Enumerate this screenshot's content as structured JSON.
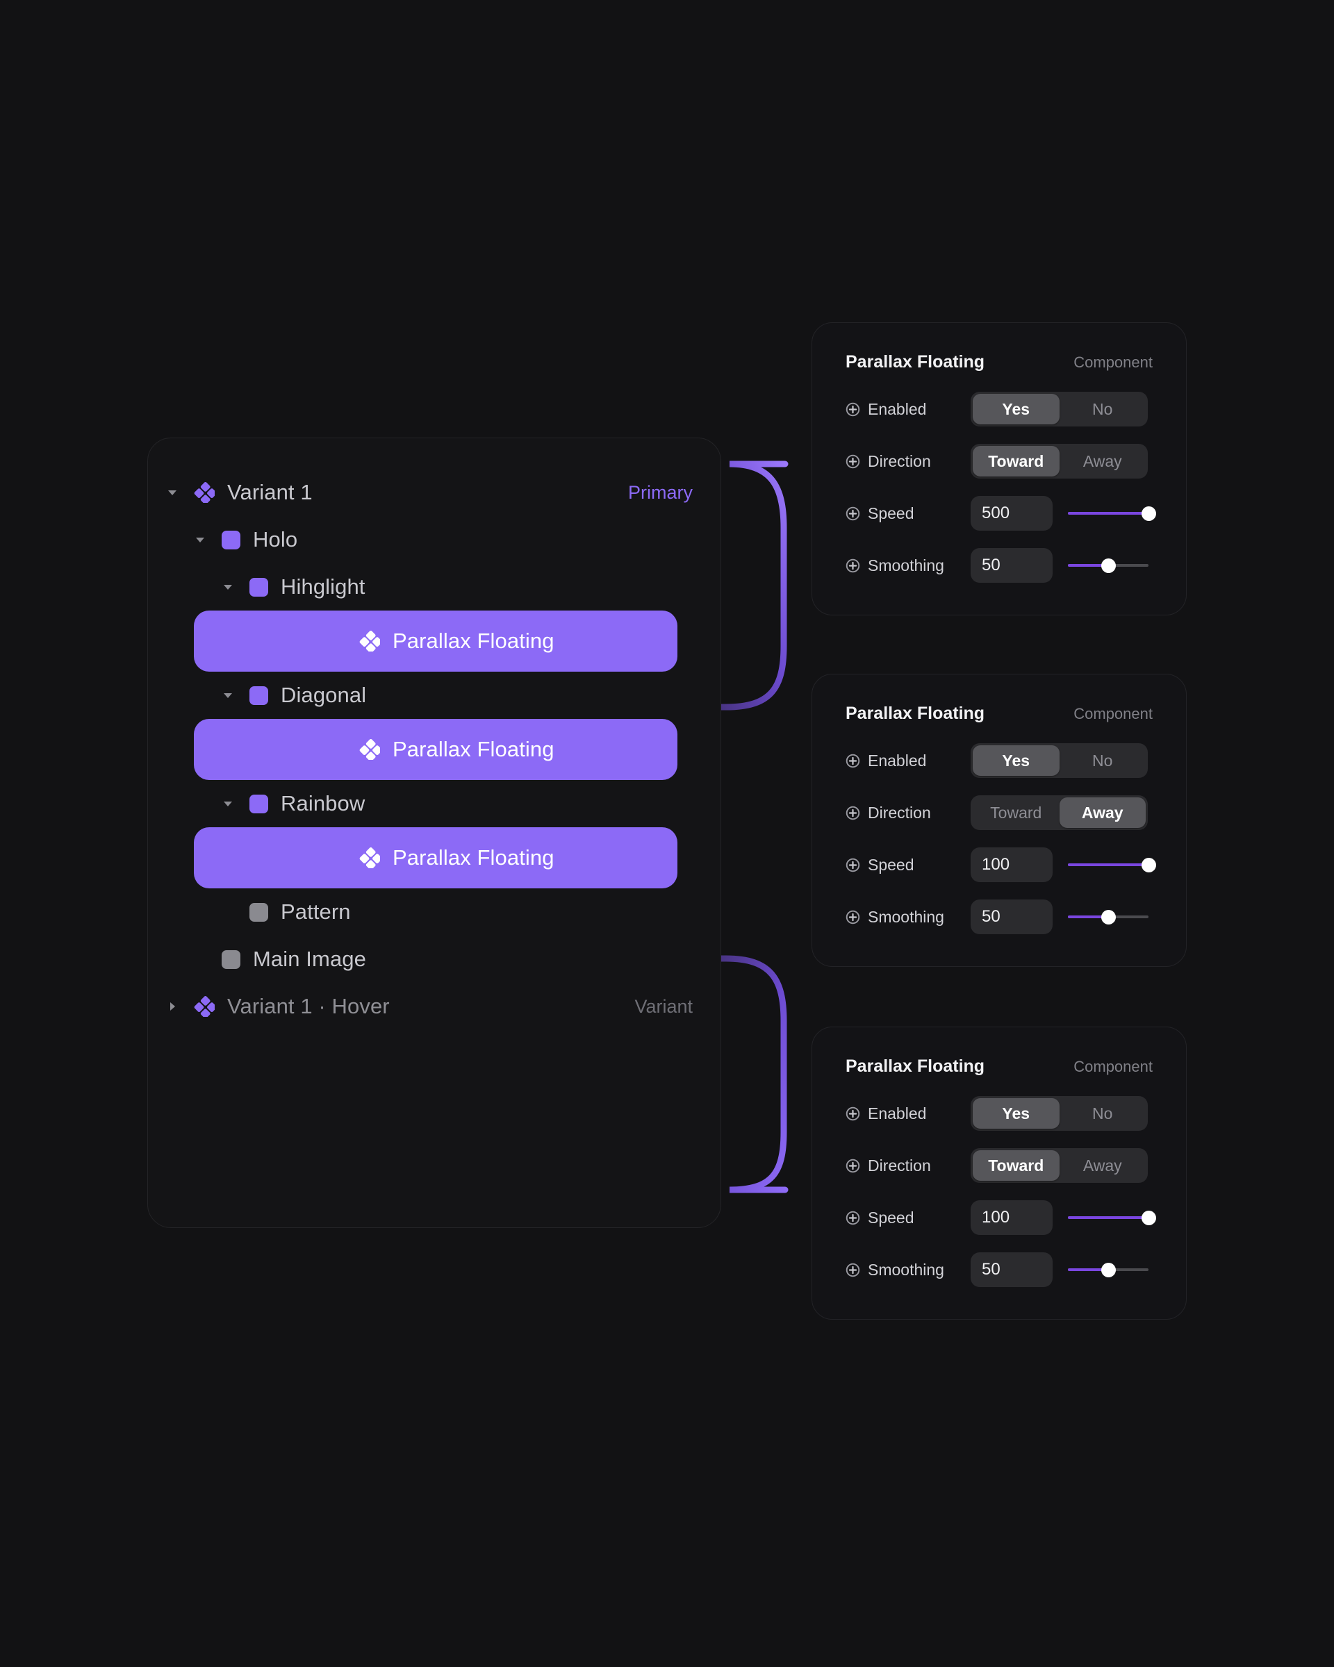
{
  "theme": {
    "background": "#121214",
    "accent_purple": "#8c6af6",
    "slider_purple": "#7a46e0",
    "card_bg": "#131316",
    "card_border": "#232327",
    "segment_track": "#2b2b2e",
    "segment_active": "#56565a",
    "text_primary": "#f2f2f4",
    "text_secondary": "#c9c9cf",
    "text_muted": "#808087"
  },
  "layer_tree": {
    "rows": [
      {
        "label": "Variant 1",
        "icon": "component-diamond-icon",
        "caret": "expanded",
        "depth": 0,
        "selected": false,
        "tag": "Primary",
        "tag_kind": "primary"
      },
      {
        "label": "Holo",
        "icon": "frame-swatch-purple-icon",
        "caret": "expanded",
        "depth": 1,
        "selected": false,
        "tag": "",
        "tag_kind": ""
      },
      {
        "label": "Hihglight",
        "icon": "frame-swatch-purple-icon",
        "caret": "expanded",
        "depth": 2,
        "selected": false,
        "tag": "",
        "tag_kind": ""
      },
      {
        "label": "Parallax Floating",
        "icon": "component-diamond-icon",
        "caret": "none",
        "depth": 3,
        "selected": true,
        "tag": "",
        "tag_kind": ""
      },
      {
        "label": "Diagonal",
        "icon": "frame-swatch-purple-icon",
        "caret": "expanded",
        "depth": 2,
        "selected": false,
        "tag": "",
        "tag_kind": ""
      },
      {
        "label": "Parallax Floating",
        "icon": "component-diamond-icon",
        "caret": "none",
        "depth": 3,
        "selected": true,
        "tag": "",
        "tag_kind": ""
      },
      {
        "label": "Rainbow",
        "icon": "frame-swatch-purple-icon",
        "caret": "expanded",
        "depth": 2,
        "selected": false,
        "tag": "",
        "tag_kind": ""
      },
      {
        "label": "Parallax Floating",
        "icon": "component-diamond-icon",
        "caret": "none",
        "depth": 3,
        "selected": true,
        "tag": "",
        "tag_kind": ""
      },
      {
        "label": "Pattern",
        "icon": "frame-swatch-gray-icon",
        "caret": "none",
        "depth": 2,
        "selected": false,
        "tag": "",
        "tag_kind": ""
      },
      {
        "label": "Main Image",
        "icon": "frame-swatch-gray-icon",
        "caret": "none",
        "depth": 1,
        "selected": false,
        "tag": "",
        "tag_kind": ""
      },
      {
        "label": "Variant 1 · Hover",
        "icon": "component-diamond-icon",
        "caret": "collapsed",
        "depth": 0,
        "selected": false,
        "tag": "Variant",
        "tag_kind": "variant"
      }
    ]
  },
  "property_cards": [
    {
      "title": "Parallax Floating",
      "kind": "Component",
      "enabled": {
        "label": "Enabled",
        "options": [
          "Yes",
          "No"
        ],
        "selected": "Yes"
      },
      "direction": {
        "label": "Direction",
        "options": [
          "Toward",
          "Away"
        ],
        "selected": "Toward"
      },
      "speed": {
        "label": "Speed",
        "value": "500",
        "slider_percent": 100
      },
      "smoothing": {
        "label": "Smoothing",
        "value": "50",
        "slider_percent": 50
      }
    },
    {
      "title": "Parallax Floating",
      "kind": "Component",
      "enabled": {
        "label": "Enabled",
        "options": [
          "Yes",
          "No"
        ],
        "selected": "Yes"
      },
      "direction": {
        "label": "Direction",
        "options": [
          "Toward",
          "Away"
        ],
        "selected": "Away"
      },
      "speed": {
        "label": "Speed",
        "value": "100",
        "slider_percent": 100
      },
      "smoothing": {
        "label": "Smoothing",
        "value": "50",
        "slider_percent": 50
      }
    },
    {
      "title": "Parallax Floating",
      "kind": "Component",
      "enabled": {
        "label": "Enabled",
        "options": [
          "Yes",
          "No"
        ],
        "selected": "Yes"
      },
      "direction": {
        "label": "Direction",
        "options": [
          "Toward",
          "Away"
        ],
        "selected": "Toward"
      },
      "speed": {
        "label": "Speed",
        "value": "100",
        "slider_percent": 100
      },
      "smoothing": {
        "label": "Smoothing",
        "value": "50",
        "slider_percent": 50
      }
    }
  ],
  "connectors": [
    {
      "name": "connector-to-card-0",
      "from_row": 3,
      "to_card": 0
    },
    {
      "name": "connector-to-card-1",
      "from_row": 5,
      "to_card": 1
    },
    {
      "name": "connector-to-card-2",
      "from_row": 7,
      "to_card": 2
    }
  ]
}
